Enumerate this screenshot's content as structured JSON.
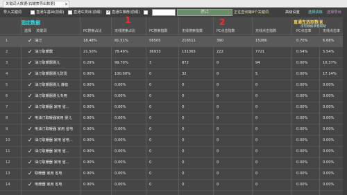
{
  "window": {
    "tab_title": "关键词大数据(石罐表导出数据)",
    "close": "✕"
  },
  "toolbar": {
    "import": "导入关键词",
    "cb1": {
      "label": "直通车基础(前缀)",
      "checked": false
    },
    "cb2": {
      "label": "直通车类目(前缀)",
      "checked": false
    },
    "cb3": {
      "label": "直通车推荐(前缀)",
      "checked": true
    },
    "cb4": {
      "label": "淘宝搜索(前缀)",
      "checked": false
    },
    "input_value": "",
    "stop": "停止",
    "status": "正在查询第8个关键词",
    "btn_settings": "高级设置",
    "btn_clear": "选择清除",
    "btn_export": "选择导出"
  },
  "annotations": {
    "fixed_data": "固定数据",
    "mark1": "1",
    "mark2": "2",
    "car_data": "直通车选取数据",
    "sub": "没有数据请看帮助"
  },
  "columns": [
    "选择",
    "关键词",
    "PC搜索占比",
    "无线搜索占比",
    "PC搜索指数",
    "无线搜索指数",
    "PC点击指数",
    "无线点击指数",
    "PC点击率",
    "无线点击率"
  ],
  "rows": [
    {
      "n": "1",
      "checked": true,
      "kw": "油汀",
      "c": [
        "18.48%",
        "81.51%",
        "56505",
        "216511",
        "390",
        "15286",
        "0.70%",
        "6.68%"
      ]
    },
    {
      "n": "2",
      "checked": true,
      "kw": "油汀取暖器",
      "c": [
        "21.50%",
        "78.49%",
        "36933",
        "131365",
        "222",
        "7721",
        "0.54%",
        "5.54%"
      ]
    },
    {
      "n": "3",
      "checked": true,
      "kw": "油汀取暖器婴儿",
      "c": [
        "0.29%",
        "99.70%",
        "3",
        "872",
        "0",
        "94",
        "0.00%",
        "10.37%"
      ]
    },
    {
      "n": "4",
      "checked": true,
      "kw": "油汀取暖器婴儿防烫",
      "c": [
        "0.00%",
        "100.00%",
        "0",
        "32",
        "0",
        "5",
        "0.00%",
        "17.14%"
      ]
    },
    {
      "n": "5",
      "checked": true,
      "kw": "油汀取暖器婴儿 静音",
      "c": [
        "0.00%",
        "0.00%",
        "0",
        "0",
        "0",
        "0",
        "0.00%",
        "0.00%"
      ]
    },
    {
      "n": "6",
      "checked": true,
      "kw": "油汀取暖器婴儿专用",
      "c": [
        "0.00%",
        "0.00%",
        "0",
        "0",
        "0",
        "0",
        "0.00%",
        "0.00%"
      ]
    },
    {
      "n": "7",
      "checked": true,
      "kw": "油汀取暖器 家用 省...",
      "c": [
        "0.00%",
        "0.00%",
        "0",
        "0",
        "0",
        "0",
        "0.00%",
        "0.00%"
      ]
    },
    {
      "n": "8",
      "checked": true,
      "kw": "电油汀取暖器家用 婴儿",
      "c": [
        "0.00%",
        "0.00%",
        "0",
        "0",
        "0",
        "0",
        "0.00%",
        "0.00%"
      ]
    },
    {
      "n": "9",
      "checked": true,
      "kw": "电油汀取暖器 家用 省电",
      "c": [
        "0.00%",
        "0.00%",
        "0",
        "0",
        "0",
        "0",
        "0.00%",
        "0.00%"
      ]
    },
    {
      "n": "10",
      "checked": true,
      "kw": "油汀取暖器 家用 省电...",
      "c": [
        "0.00%",
        "0.00%",
        "0",
        "0",
        "0",
        "0",
        "0.00%",
        "0.00%"
      ]
    },
    {
      "n": "11",
      "checked": true,
      "kw": "油汀取暖器 家用 省...",
      "c": [
        "0.00%",
        "0.00%",
        "0",
        "0",
        "0",
        "0",
        "0.00%",
        "0.00%"
      ]
    },
    {
      "n": "12",
      "checked": true,
      "kw": "油汀取暖器 家用 省...",
      "c": [
        "0.00%",
        "0.00%",
        "0",
        "0",
        "0",
        "0",
        "0.00%",
        "0.00%"
      ]
    },
    {
      "n": "13",
      "checked": true,
      "kw": "取暖器 家用 省电",
      "c": [
        "0.00%",
        "0.00%",
        "0",
        "0",
        "0",
        "0",
        "0.00%",
        "0.00%"
      ]
    },
    {
      "n": "14",
      "checked": true,
      "kw": "电暖器 家用 省电",
      "c": [
        "0.00%",
        "0.00%",
        "0",
        "0",
        "0",
        "0",
        "0.00%",
        "0.00%"
      ]
    }
  ]
}
